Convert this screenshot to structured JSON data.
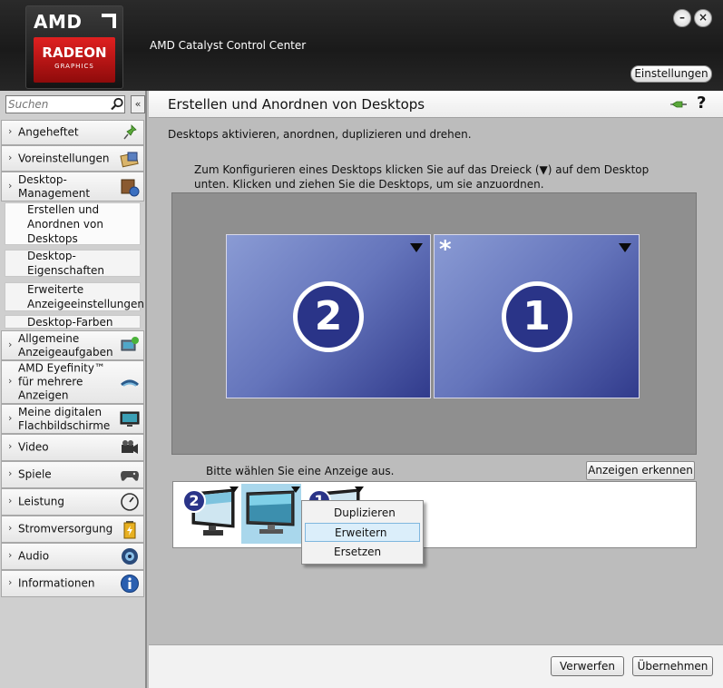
{
  "app": {
    "title": "AMD Catalyst Control Center",
    "logo": {
      "brand": "AMD",
      "product": "RADEON",
      "sub": "GRAPHICS"
    },
    "settings_button": "Einstellungen",
    "minimize_label": "–",
    "close_label": "×"
  },
  "sidebar": {
    "search_placeholder": "Suchen",
    "collapse_label": "«",
    "items": [
      {
        "label": "Angeheftet",
        "icon": "pin-icon"
      },
      {
        "label": "Voreinstellungen",
        "icon": "presets-icon"
      },
      {
        "label": "Desktop-Management",
        "icon": "desktop-management-icon",
        "expanded": true,
        "children": [
          {
            "label": "Erstellen und Anordnen von Desktops",
            "selected": true
          },
          {
            "label": "Desktop-Eigenschaften"
          },
          {
            "label": "Erweiterte Anzeigeeinstellungen"
          },
          {
            "label": "Desktop-Farben"
          }
        ]
      },
      {
        "label": "Allgemeine Anzeigeaufgaben",
        "icon": "display-tasks-icon"
      },
      {
        "label": "AMD Eyefinity™ für mehrere Anzeigen",
        "icon": "eyefinity-icon"
      },
      {
        "label": "Meine digitalen Flachbildschirme",
        "icon": "flat-panel-icon"
      },
      {
        "label": "Video",
        "icon": "video-camera-icon"
      },
      {
        "label": "Spiele",
        "icon": "gamepad-icon"
      },
      {
        "label": "Leistung",
        "icon": "gauge-icon"
      },
      {
        "label": "Stromversorgung",
        "icon": "power-battery-icon"
      },
      {
        "label": "Audio",
        "icon": "speaker-icon"
      },
      {
        "label": "Informationen",
        "icon": "info-icon"
      }
    ]
  },
  "main": {
    "title": "Erstellen und Anordnen von Desktops",
    "help_label": "?",
    "description": "Desktops aktivieren, anordnen, duplizieren und drehen.",
    "instructions": "Zum Konfigurieren eines Desktops klicken Sie auf das Dreieck (▼) auf dem Desktop unten.  Klicken und ziehen Sie die Desktops, um sie anzuordnen.",
    "desktops": [
      {
        "number": "2",
        "primary": false
      },
      {
        "number": "1",
        "primary": true,
        "marker": "*"
      }
    ],
    "select_display_text": "Bitte wählen Sie eine Anzeige aus.",
    "identify_button": "Anzeigen erkennen",
    "displays": [
      {
        "badge": "2"
      },
      {
        "badge": "",
        "highlighted": true
      },
      {
        "badge": "1"
      }
    ],
    "context_menu": {
      "items": [
        "Duplizieren",
        "Erweitern",
        "Ersetzen"
      ],
      "highlighted": "Erweitern"
    },
    "buttons": {
      "discard": "Verwerfen",
      "apply": "Übernehmen"
    }
  },
  "colors": {
    "header_bg": "#1f1f1f",
    "desktop_tile": "#5f6fb8",
    "desktop_badge": "#2a3488",
    "radeon_red": "#c41515",
    "menu_highlight": "#dbeefa"
  }
}
